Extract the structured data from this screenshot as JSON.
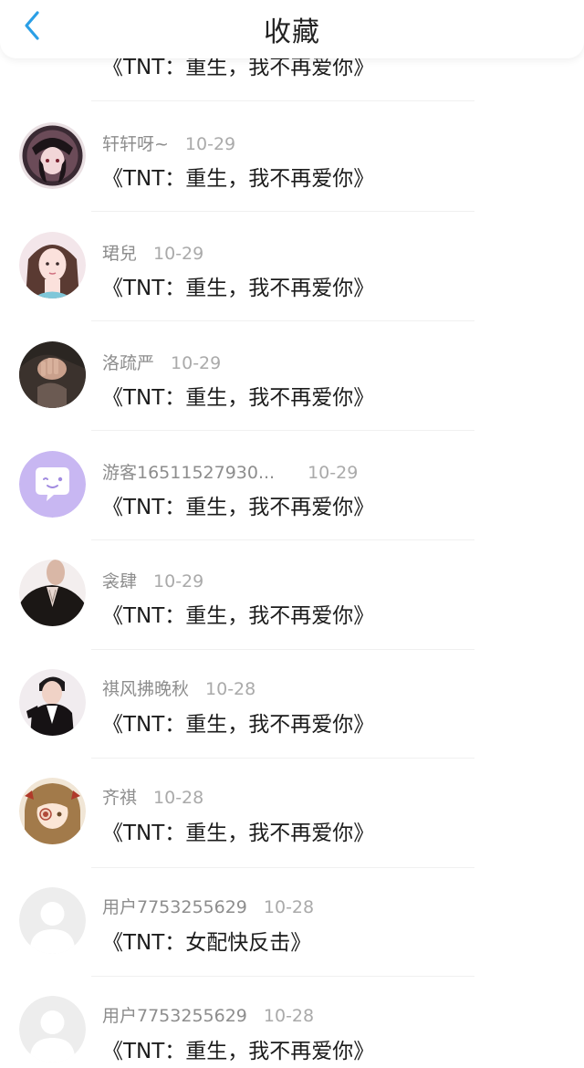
{
  "header": {
    "title": "收藏"
  },
  "colors": {
    "accent": "#2b9fe6",
    "divider": "#f0f0f0"
  },
  "items": [
    {
      "name": "",
      "date": "",
      "book": "《TNT：重生，我不再爱你》",
      "avatar": "partial-avatar"
    },
    {
      "name": "轩轩呀~",
      "date": "10-29",
      "book": "《TNT：重生，我不再爱你》",
      "avatar": "dark-girl-avatar"
    },
    {
      "name": "珺兒",
      "date": "10-29",
      "book": "《TNT：重生，我不再爱你》",
      "avatar": "cartoon-girl-avatar"
    },
    {
      "name": "洛疏严",
      "date": "10-29",
      "book": "《TNT：重生，我不再爱你》",
      "avatar": "hand-photo-avatar"
    },
    {
      "name": "游客16511527930...",
      "date": "10-29",
      "book": "《TNT：重生，我不再爱你》",
      "avatar": "chat-bubble-avatar"
    },
    {
      "name": "衾肆",
      "date": "10-29",
      "book": "《TNT：重生，我不再爱你》",
      "avatar": "man-suit-avatar"
    },
    {
      "name": "祺风拂晚秋",
      "date": "10-28",
      "book": "《TNT：重生，我不再爱你》",
      "avatar": "boy-photo-avatar"
    },
    {
      "name": "齐祺",
      "date": "10-28",
      "book": "《TNT：重生，我不再爱你》",
      "avatar": "anime-girl-avatar"
    },
    {
      "name": "用户7753255629",
      "date": "10-28",
      "book": "《TNT：女配快反击》",
      "avatar": "default-user-avatar"
    },
    {
      "name": "用户7753255629",
      "date": "10-28",
      "book": "《TNT：重生，我不再爱你》",
      "avatar": "default-user-avatar"
    }
  ]
}
